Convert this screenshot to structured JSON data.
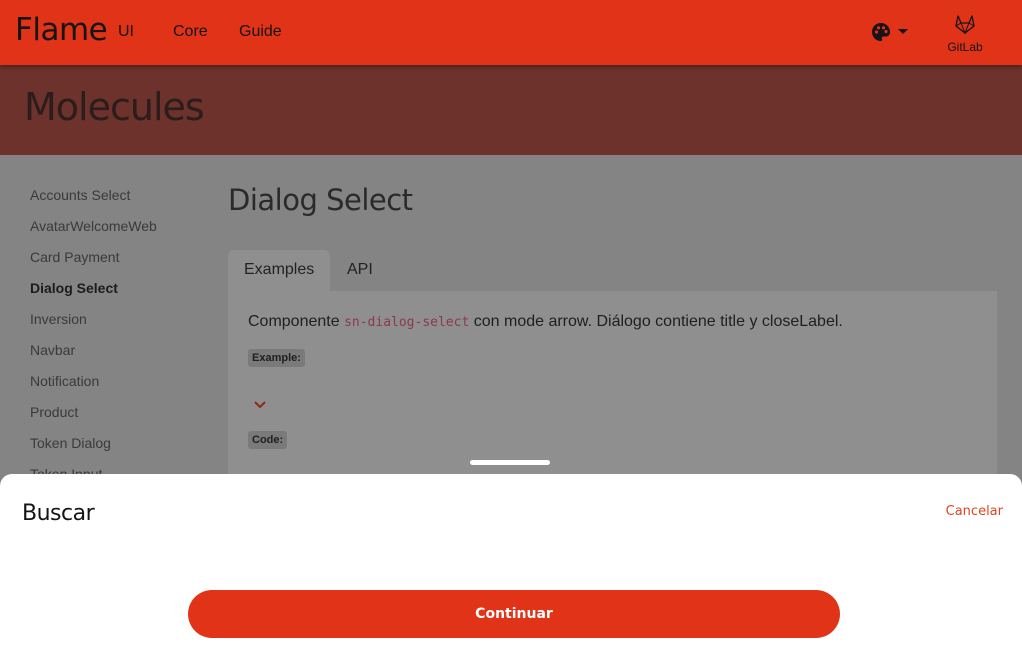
{
  "app": {
    "logo": "Flame",
    "nav": [
      "UI",
      "Core",
      "Guide"
    ],
    "gitlab_label": "GitLab"
  },
  "page_title": "Molecules",
  "sidebar": {
    "items": [
      {
        "label": "Accounts Select",
        "active": false
      },
      {
        "label": "AvatarWelcomeWeb",
        "active": false
      },
      {
        "label": "Card Payment",
        "active": false
      },
      {
        "label": "Dialog Select",
        "active": true
      },
      {
        "label": "Inversion",
        "active": false
      },
      {
        "label": "Navbar",
        "active": false
      },
      {
        "label": "Notification",
        "active": false
      },
      {
        "label": "Product",
        "active": false
      },
      {
        "label": "Token Dialog",
        "active": false
      },
      {
        "label": "Token Input",
        "active": false
      }
    ]
  },
  "main": {
    "title": "Dialog Select",
    "tabs": [
      "Examples",
      "API"
    ],
    "description_before": "Componente ",
    "description_code": "sn-dialog-select",
    "description_after": " con mode arrow. Diálogo contiene title y closeLabel.",
    "example_label": "Example:",
    "code_label": "Code:"
  },
  "sheet": {
    "title": "Buscar",
    "close_label": "Cancelar",
    "continue_label": "Continuar"
  },
  "icons": {
    "theme": "palette-icon",
    "dropdown": "caret-down-icon",
    "gitlab": "gitlab-icon",
    "chevron": "chevron-down-icon"
  },
  "colors": {
    "brand": "#e03318",
    "header_band": "#6d322b",
    "overlay_content": "#848484",
    "code_text": "#8a3a4a",
    "cancel_text": "#e0431f"
  }
}
